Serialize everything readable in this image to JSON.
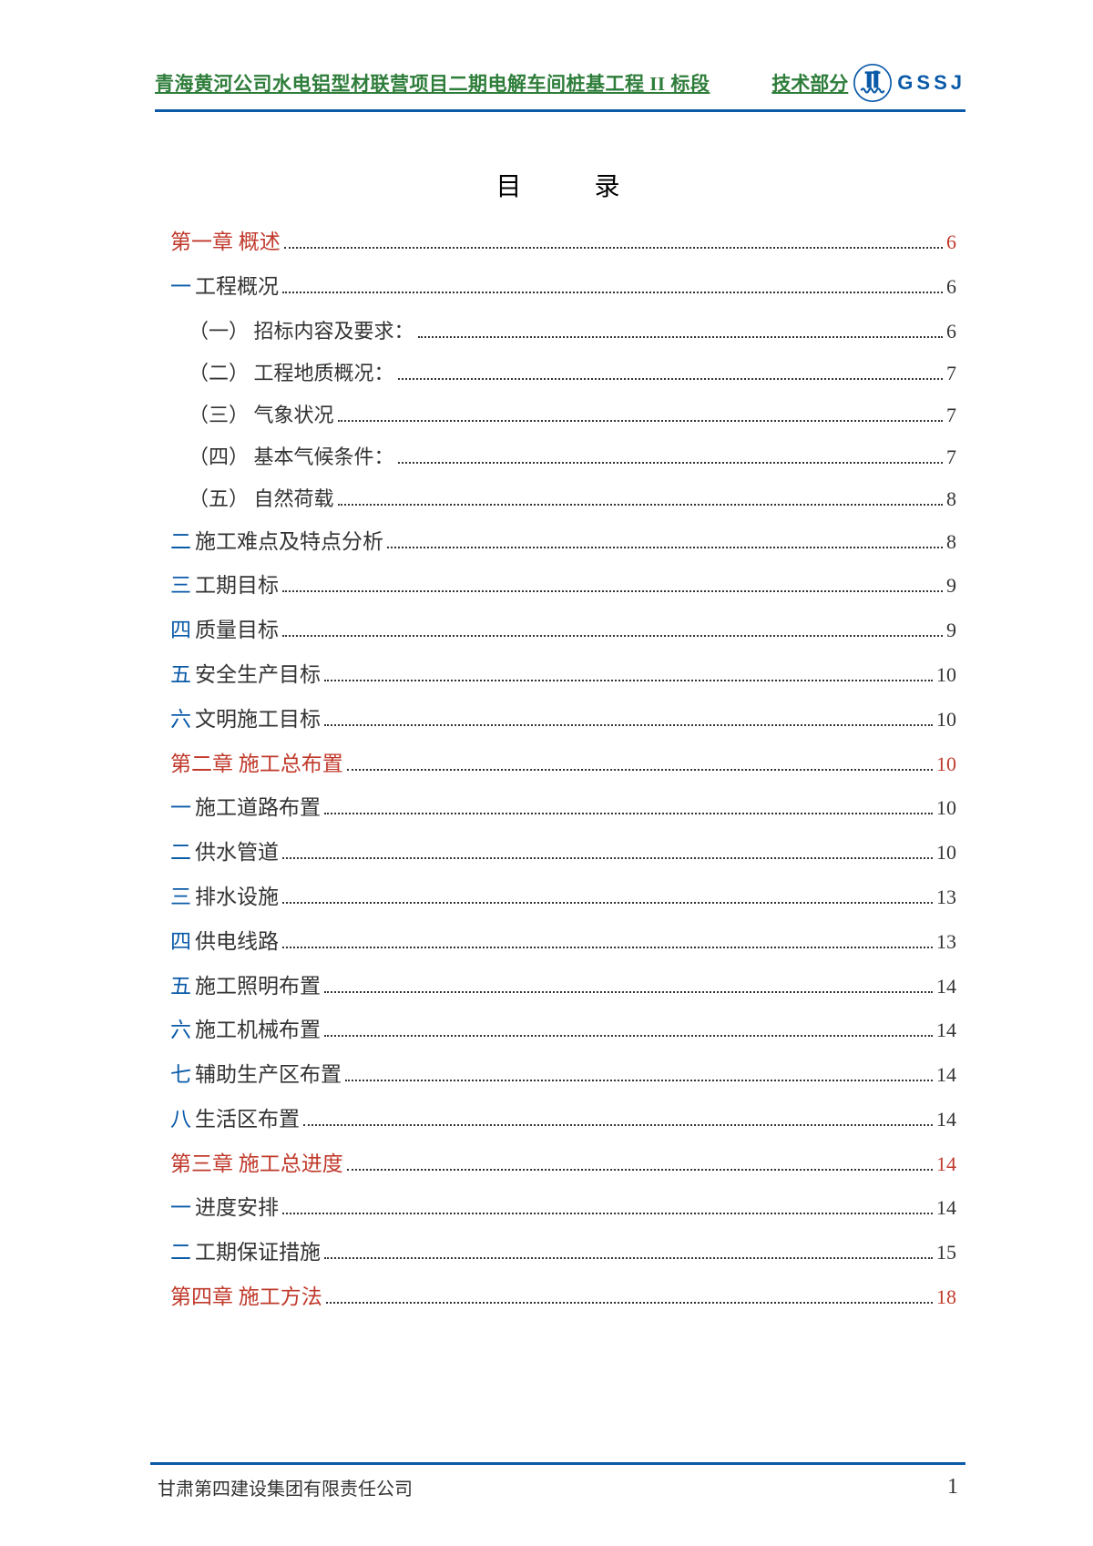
{
  "header": {
    "title": "青海黄河公司水电铝型材联营项目二期电解车间桩基工程 II 标段",
    "tech": "技术部分",
    "logo_text": "GSSJ"
  },
  "toc_title": "目录",
  "toc": [
    {
      "type": "chapter",
      "label": "第一章 概述",
      "page": "6"
    },
    {
      "type": "section",
      "num": "一",
      "text": "工程概况",
      "page": "6"
    },
    {
      "type": "sub",
      "label": "（一） 招标内容及要求：",
      "page": "6"
    },
    {
      "type": "sub",
      "label": "（二） 工程地质概况：",
      "page": "7"
    },
    {
      "type": "sub",
      "label": "（三） 气象状况",
      "page": "7"
    },
    {
      "type": "sub",
      "label": "（四） 基本气候条件：",
      "page": "7"
    },
    {
      "type": "sub",
      "label": "（五） 自然荷载",
      "page": "8"
    },
    {
      "type": "section",
      "num": "二",
      "text": "施工难点及特点分析",
      "page": "8"
    },
    {
      "type": "section",
      "num": "三",
      "text": "工期目标",
      "page": "9"
    },
    {
      "type": "section",
      "num": "四",
      "text": "质量目标",
      "page": "9"
    },
    {
      "type": "section",
      "num": "五",
      "text": "安全生产目标",
      "page": "10"
    },
    {
      "type": "section",
      "num": "六",
      "text": "文明施工目标",
      "page": "10"
    },
    {
      "type": "chapter",
      "label": "第二章 施工总布置",
      "page": "10"
    },
    {
      "type": "section",
      "num": "一",
      "text": "施工道路布置",
      "page": "10"
    },
    {
      "type": "section",
      "num": "二",
      "text": "供水管道",
      "page": "10"
    },
    {
      "type": "section",
      "num": "三",
      "text": "排水设施",
      "page": "13"
    },
    {
      "type": "section",
      "num": "四",
      "text": "供电线路",
      "page": "13"
    },
    {
      "type": "section",
      "num": "五",
      "text": "施工照明布置",
      "page": "14"
    },
    {
      "type": "section",
      "num": "六",
      "text": "施工机械布置",
      "page": "14"
    },
    {
      "type": "section",
      "num": "七",
      "text": "辅助生产区布置",
      "page": "14"
    },
    {
      "type": "section",
      "num": "八",
      "text": "生活区布置",
      "page": "14"
    },
    {
      "type": "chapter",
      "label": "第三章 施工总进度",
      "page": "14"
    },
    {
      "type": "section",
      "num": "一",
      "text": "进度安排",
      "page": "14"
    },
    {
      "type": "section",
      "num": "二",
      "text": "工期保证措施",
      "page": "15"
    },
    {
      "type": "chapter",
      "label": "第四章 施工方法",
      "page": "18"
    }
  ],
  "footer": {
    "company": "甘肃第四建设集团有限责任公司",
    "page_number": "1"
  }
}
